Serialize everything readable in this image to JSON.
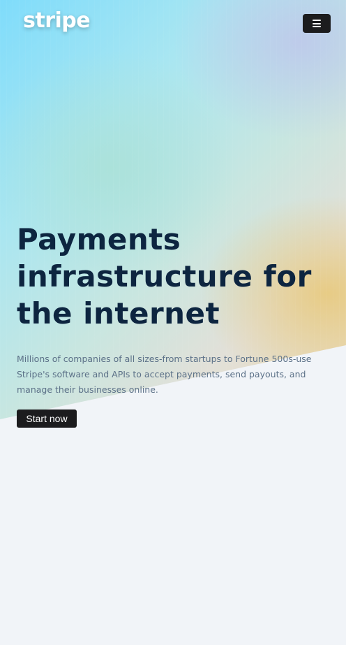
{
  "header": {
    "logo_text": "stripe",
    "menu_icon": "hamburger-menu-icon"
  },
  "hero": {
    "headline": "Payments infrastructure for the internet",
    "subtext": "Millions of companies of all sizes-from startups to Fortune 500s-use Stripe's software and APIs to accept payments, send payouts, and manage their businesses online.",
    "cta_label": "Start now"
  },
  "colors": {
    "background": "#f1f4f8",
    "headline": "#0d2540",
    "subtext": "#5c7188",
    "button": "#1c1c1e",
    "gradient_cyan": "#7fdcfb",
    "gradient_gold": "#ead9b4"
  }
}
